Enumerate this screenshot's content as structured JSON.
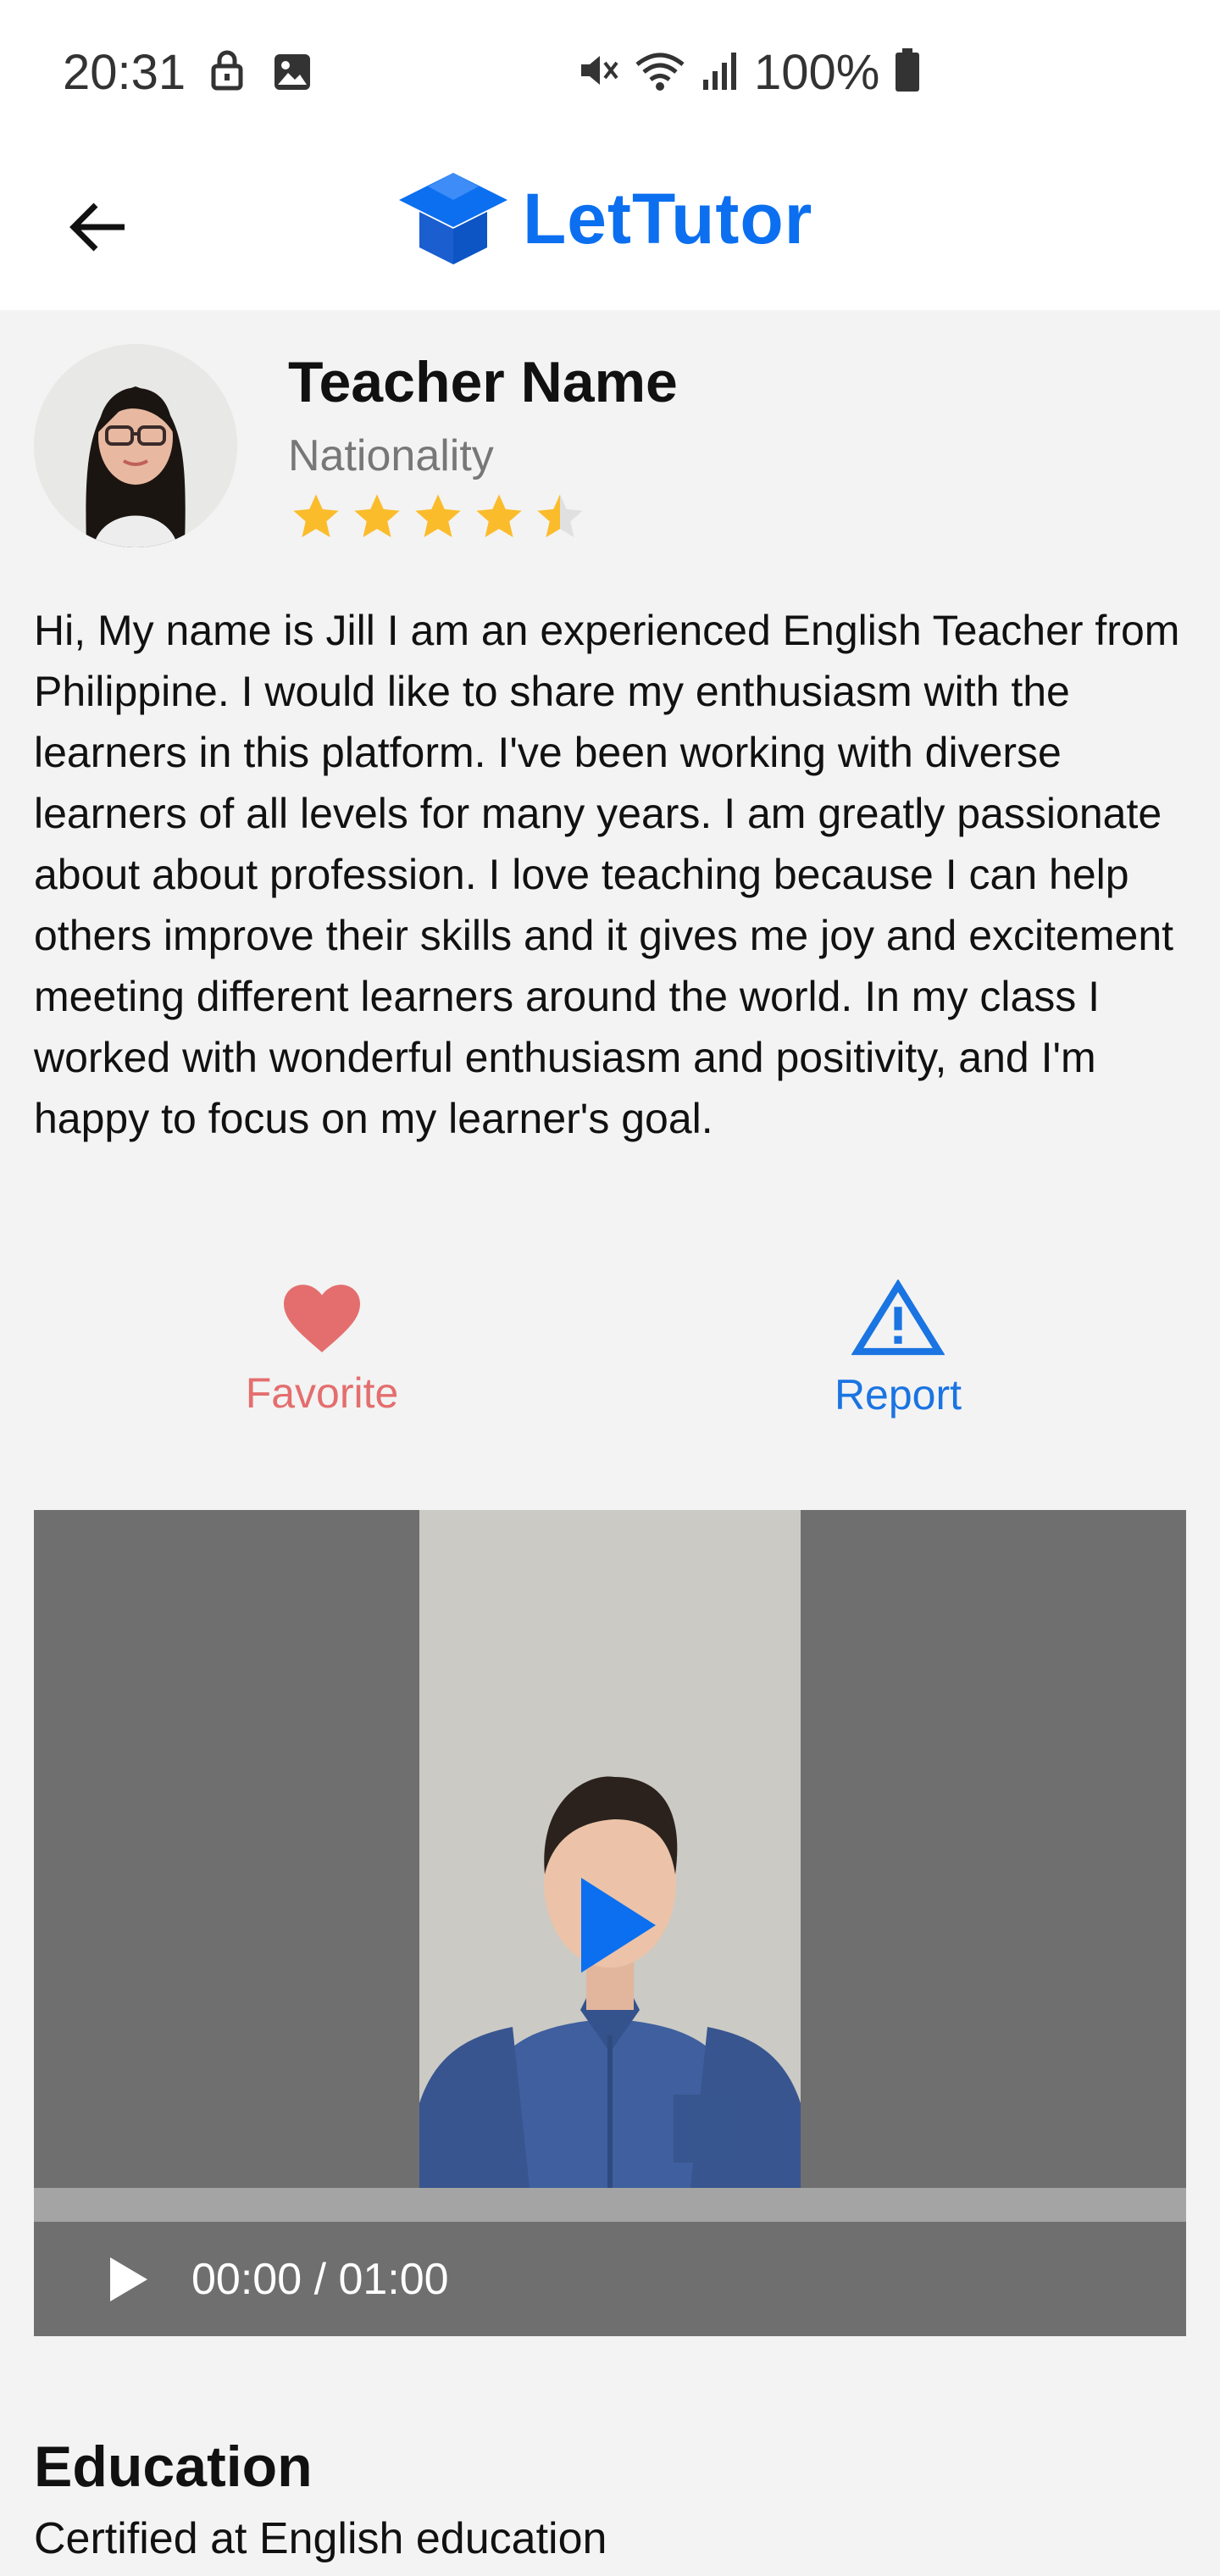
{
  "status_bar": {
    "time": "20:31",
    "battery": "100%"
  },
  "app_bar": {
    "logo_text": "LetTutor",
    "brand_color": "#0b6ff0",
    "back_icon": "arrow-left-icon"
  },
  "teacher": {
    "name": "Teacher Name",
    "nationality": "Nationality",
    "rating": 4.5,
    "rating_max": 5,
    "bio": "Hi, My name is Jill I am an experienced English Teacher from Philippine. I would like to share my enthusiasm with the learners in this platform. I've been working with diverse learners of all levels for many years. I am greatly passionate about about profession. I love teaching because I can help others improve their skills and it gives me joy and excitement meeting different learners around the world. In my class I worked with wonderful enthusiasm and positivity, and I'm happy to focus on my learner's goal."
  },
  "actions": {
    "favorite_label": "Favorite",
    "favorite_color": "#e46e6e",
    "report_label": "Report",
    "report_color": "#1a74e2"
  },
  "video": {
    "time_display": "00:00 / 01:00",
    "progress": 0
  },
  "education": {
    "title": "Education",
    "text": "Certified at English education"
  }
}
